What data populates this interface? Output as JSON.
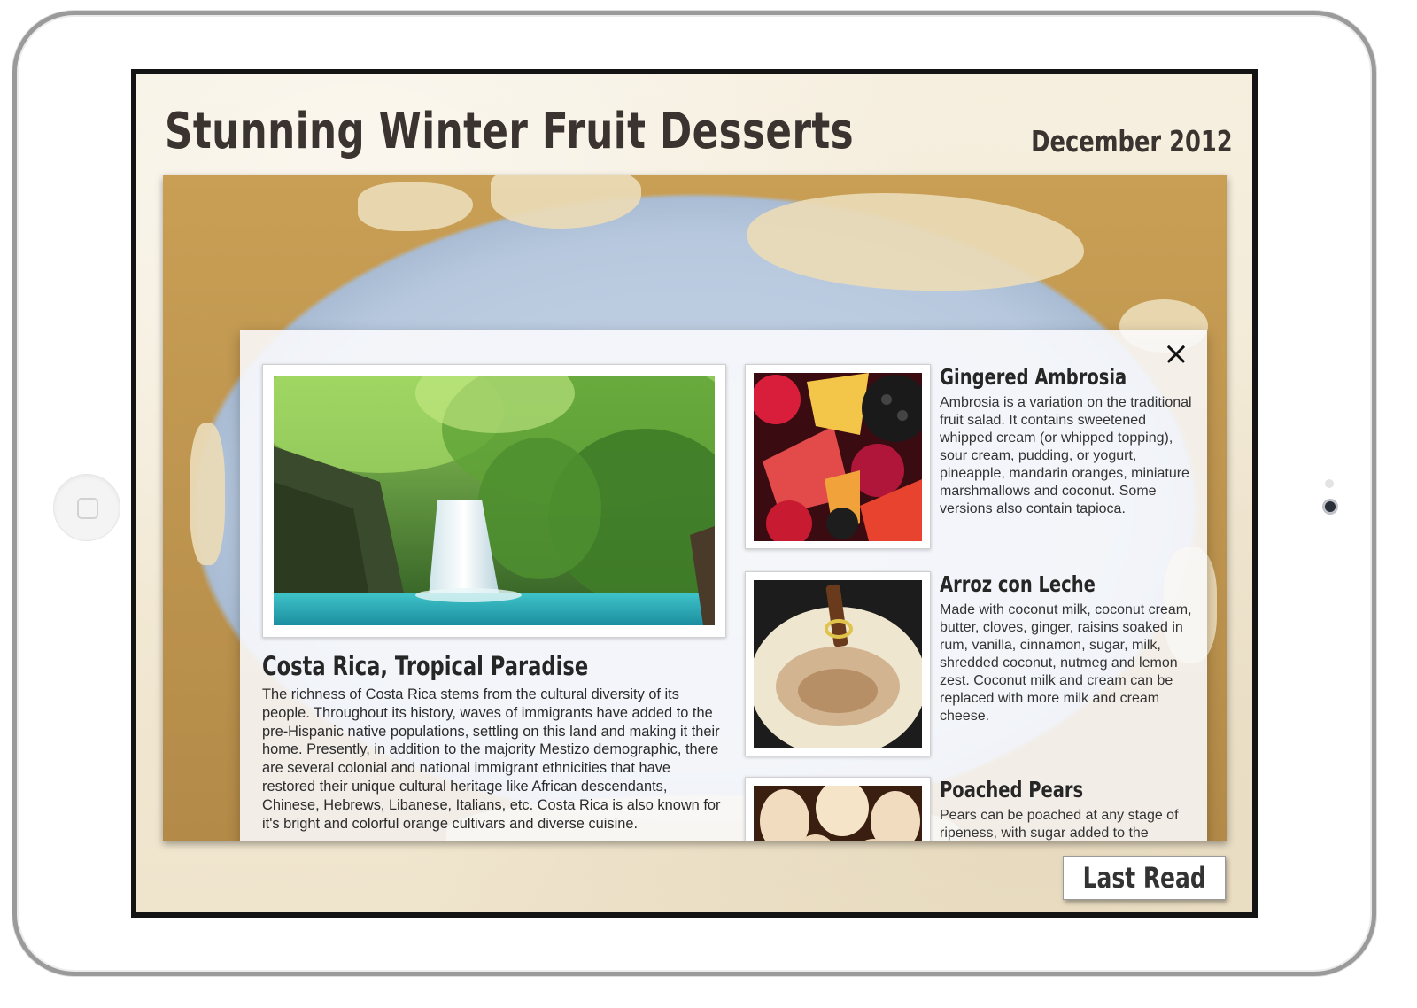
{
  "page": {
    "title": "Stunning Winter Fruit Desserts",
    "issue_date": "December 2012"
  },
  "panel": {
    "close_icon": "×",
    "article": {
      "heading": "Costa Rica, Tropical Paradise",
      "body": "The richness of Costa Rica stems from the cultural diversity of its people. Throughout its history, waves of immigrants have added to the pre-Hispanic native populations, settling on this land and making it their home. Presently, in addition to the majority Mestizo demographic, there are several colonial and national immigrant ethnicities that have restored their unique cultural heritage like African descendants, Chinese, Hebrews, Libanese, Italians, etc. Costa Rica is also known for it's bright and colorful orange cultivars and diverse cuisine.",
      "image": "waterfall-photo"
    },
    "recipes": [
      {
        "title": "Gingered Ambrosia",
        "body": "Ambrosia is a variation on the traditional fruit salad. It contains sweetened whipped cream (or whipped topping), sour cream, pudding, or yogurt, pineapple, mandarin oranges, miniature marshmallows and coconut. Some versions also contain tapioca.",
        "image": "fruit-salad-photo"
      },
      {
        "title": "Arroz con Leche",
        "body": "Made with coconut milk, coconut cream, butter, cloves, ginger, raisins soaked in rum, vanilla, cinnamon, sugar, milk, shredded coconut, nutmeg and lemon zest. Coconut milk and cream can be replaced with more milk and cream cheese.",
        "image": "rice-pudding-photo"
      },
      {
        "title": "Poached Pears",
        "body": "Pears can be poached at any stage of ripeness, with sugar added to the cooking water making up for",
        "image": "poached-pears-photo"
      }
    ]
  },
  "footer": {
    "last_read_label": "Last Read"
  },
  "colors": {
    "screen_bezel": "#141414",
    "paper": "#f2e9d6",
    "heading_text": "#3a3330",
    "ocean": "#b7c8de",
    "map_edge": "#b38a48"
  }
}
